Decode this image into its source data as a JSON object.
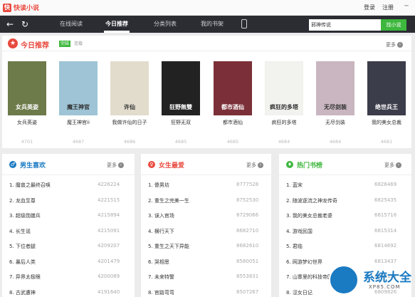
{
  "app": {
    "logo_letter": "快",
    "title": "快读小说"
  },
  "top_links": {
    "login": "登录",
    "register": "注册",
    "minimize": "─"
  },
  "nav": {
    "back": "←",
    "refresh": "↻",
    "tabs": [
      "在线阅读",
      "今日推荐",
      "分类列表",
      "我的书架"
    ],
    "active_tab": 1,
    "search_value": "邪神传说",
    "search_button": "找小说"
  },
  "recommend": {
    "title": "今日推荐",
    "tag_done": "完结",
    "tag_serial": "连载",
    "more": "更多",
    "books": [
      {
        "name": "女兵英姿",
        "count": "4701",
        "cover_bg": "#6d7a4a",
        "cover_text": "女兵英姿"
      },
      {
        "name": "魔王神官ii",
        "count": "4687",
        "cover_bg": "#9ec4d6",
        "cover_text": "魔王神官"
      },
      {
        "name": "我做许仙的日子",
        "count": "4686",
        "cover_bg": "#e2dccd",
        "cover_text": "许仙"
      },
      {
        "name": "狂野无双",
        "count": "4685",
        "cover_bg": "#222222",
        "cover_text": "狂野無雙"
      },
      {
        "name": "都市酒仙",
        "count": "4685",
        "cover_bg": "#7b2f38",
        "cover_text": "都市酒仙"
      },
      {
        "name": "疯狂的多塔",
        "count": "4684",
        "cover_bg": "#f2f2ee",
        "cover_text": "疯狂的多塔"
      },
      {
        "name": "无尽剑装",
        "count": "4684",
        "cover_bg": "#c9b6c0",
        "cover_text": "无尽剑装"
      },
      {
        "name": "我的美女总裁",
        "count": "4681",
        "cover_bg": "#3b3d4a",
        "cover_text": "绝世兵王"
      }
    ]
  },
  "lists": [
    {
      "title": "男生喜欢",
      "icon": "♂",
      "color": "#1a7ac2",
      "more": "更多",
      "rows": [
        {
          "rank": "1.",
          "name": "魔兽之最终召唤",
          "count": "4226224"
        },
        {
          "rank": "2.",
          "name": "龙血至尊",
          "count": "4221515"
        },
        {
          "rank": "3.",
          "name": "超级勋膳兵",
          "count": "4215894"
        },
        {
          "rank": "4.",
          "name": "长生谣",
          "count": "4215091"
        },
        {
          "rank": "5.",
          "name": "下位者腿",
          "count": "4209207"
        },
        {
          "rank": "6.",
          "name": "暴后人类",
          "count": "4201479"
        },
        {
          "rank": "7.",
          "name": "异界太极眼",
          "count": "4200089"
        },
        {
          "rank": "8.",
          "name": "古武遭神",
          "count": "4191640"
        }
      ]
    },
    {
      "title": "女生最爱",
      "icon": "♀",
      "color": "#e94a3f",
      "more": "更多",
      "rows": [
        {
          "rank": "1.",
          "name": "傻男坊",
          "count": "8777528"
        },
        {
          "rank": "2.",
          "name": "重生之完美一生",
          "count": "8752530"
        },
        {
          "rank": "3.",
          "name": "误入官场",
          "count": "8729066"
        },
        {
          "rank": "4.",
          "name": "横行天下",
          "count": "8682710"
        },
        {
          "rank": "5.",
          "name": "重生之天下异能",
          "count": "8682610"
        },
        {
          "rank": "6.",
          "name": "哭相思",
          "count": "8580051"
        },
        {
          "rank": "7.",
          "name": "未来特警",
          "count": "8553831"
        },
        {
          "rank": "8.",
          "name": "官路弯弯",
          "count": "8507267"
        }
      ]
    },
    {
      "title": "热门书榜",
      "icon": "♦",
      "color": "#3db73d",
      "more": "更多",
      "rows": [
        {
          "rank": "1.",
          "name": "蓝宋",
          "count": "6826469"
        },
        {
          "rank": "2.",
          "name": "随波逐流之神龙传奇",
          "count": "6825435"
        },
        {
          "rank": "3.",
          "name": "我的美女总裁老婆",
          "count": "6815716"
        },
        {
          "rank": "4.",
          "name": "游戏民国",
          "count": "6815314"
        },
        {
          "rank": "5.",
          "name": "君临",
          "count": "6814692"
        },
        {
          "rank": "6.",
          "name": "网游梦幻世界",
          "count": "6813437"
        },
        {
          "rank": "7.",
          "name": "山寨里的科技帝国",
          "count": "6813121"
        },
        {
          "rank": "8.",
          "name": "涩女日记",
          "count": "6809826"
        }
      ]
    }
  ],
  "watermark": {
    "text": "系统大全",
    "url": "XP85.COM"
  }
}
